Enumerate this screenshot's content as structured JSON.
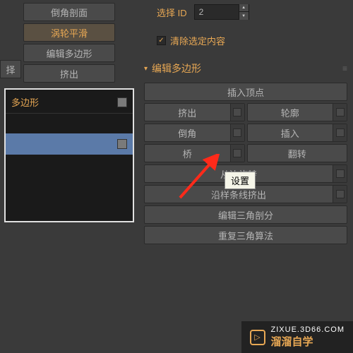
{
  "leftButtons": {
    "chamfer": "倒角剖面",
    "narrow": "择",
    "turbo": "涡轮平滑",
    "editPoly": "编辑多边形",
    "extrude": "挤出"
  },
  "listBox": {
    "header": "多边形",
    "row2": ""
  },
  "rightTop": {
    "selectLabel": "选择 ID",
    "selectValue": "2",
    "clearLabel": "清除选定内容"
  },
  "section": {
    "title": "编辑多边形"
  },
  "editButtons": {
    "insertVertex": "插入顶点",
    "extrude": "挤出",
    "outline": "轮廓",
    "bevel": "倒角",
    "insert": "插入",
    "bridge": "桥",
    "flip": "翻转",
    "spinEdge": "从边旋转",
    "extrudeSpline": "沿样条线挤出",
    "editTri": "编辑三角剖分",
    "retri": "重复三角算法"
  },
  "tooltip": "设置",
  "watermark": {
    "line1": "ZIXUE.3D66.COM",
    "line2": "溜溜自学"
  }
}
